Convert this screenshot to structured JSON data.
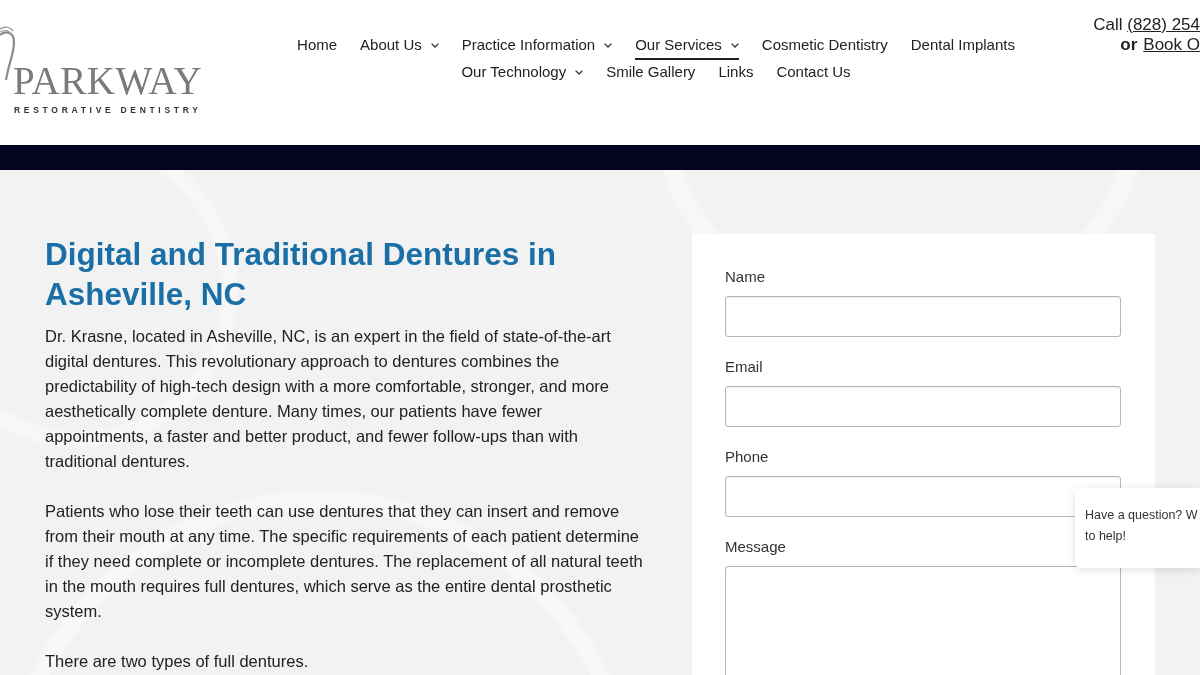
{
  "header": {
    "logo": {
      "name": "PARKWAY",
      "tagline": "RESTORATIVE DENTISTRY"
    },
    "nav": [
      {
        "label": "Home",
        "dropdown": false,
        "selected": false
      },
      {
        "label": "About Us",
        "dropdown": true,
        "selected": false
      },
      {
        "label": "Practice Information",
        "dropdown": true,
        "selected": false
      },
      {
        "label": "Our Services",
        "dropdown": true,
        "selected": true
      },
      {
        "label": "Cosmetic Dentistry",
        "dropdown": false,
        "selected": false
      },
      {
        "label": "Dental Implants",
        "dropdown": false,
        "selected": false
      },
      {
        "label": "Our Technology",
        "dropdown": true,
        "selected": false
      },
      {
        "label": "Smile Gallery",
        "dropdown": false,
        "selected": false
      },
      {
        "label": "Links",
        "dropdown": false,
        "selected": false
      },
      {
        "label": "Contact Us",
        "dropdown": false,
        "selected": false
      }
    ],
    "contact": {
      "call_label": "Call",
      "phone": "(828) 254",
      "or_label": "or",
      "booking_link": "Book O"
    }
  },
  "content": {
    "heading": "Digital and Traditional Dentures in Asheville, NC",
    "paragraphs": [
      "Dr. Krasne, located in Asheville, NC, is an expert in the field of state-of-the-art digital dentures. This revolutionary approach to dentures combines the predictability of high-tech design with a more comfortable, stronger, and more aesthetically complete denture. Many times, our patients have fewer appointments, a faster and better product, and fewer follow-ups than with traditional dentures.",
      "Patients who lose their teeth can use dentures that they can insert and remove from their mouth at any time. The specific requirements of each patient determine if they need complete or incomplete dentures. The replacement of all natural teeth in the mouth requires full dentures, which serve as the entire dental prosthetic system.",
      "There are two types of full dentures."
    ]
  },
  "form": {
    "fields": [
      {
        "label": "Name",
        "kind": "text"
      },
      {
        "label": "Email",
        "kind": "text"
      },
      {
        "label": "Phone",
        "kind": "text"
      },
      {
        "label": "Message",
        "kind": "textarea"
      }
    ]
  },
  "chat_popup": {
    "lines": [
      "Have a question? W",
      "to help!"
    ]
  }
}
